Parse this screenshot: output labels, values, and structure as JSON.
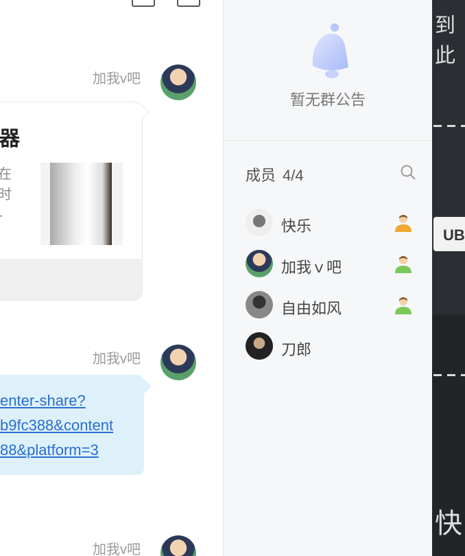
{
  "chat": {
    "messages": [
      {
        "sender": "加我v吧",
        "type": "card",
        "card": {
          "title_fragment": "器",
          "desc_fragments": [
            "在",
            "时",
            "-"
          ]
        }
      },
      {
        "sender": "加我v吧",
        "type": "link",
        "link_lines": [
          "enter-share?",
          "b9fc388&content",
          "88&platform=3"
        ]
      },
      {
        "sender": "加我v吧"
      }
    ]
  },
  "sidebar": {
    "notice": {
      "icon": "bell-icon",
      "text": "暂无群公告"
    },
    "members_title": "成员",
    "members_count": "4/4",
    "search_icon": "search-icon",
    "members": [
      {
        "name": "快乐",
        "role_icon": "admin-person-icon",
        "role_color": "#f0a830"
      },
      {
        "name": "加我ｖ吧",
        "role_icon": "person-icon",
        "role_color": "#7cc95a"
      },
      {
        "name": "自由如风",
        "role_icon": "person-icon",
        "role_color": "#7cc95a"
      },
      {
        "name": "刀郎",
        "role_icon": ""
      }
    ]
  },
  "background": {
    "top_text": "到此",
    "button_label": "UB",
    "bottom_text": "快"
  },
  "colors": {
    "link": "#2a6ed0",
    "link_bubble": "#def1fb",
    "sidebar_bg": "#f6f7f9",
    "dark_bg": "#2b2f33"
  }
}
